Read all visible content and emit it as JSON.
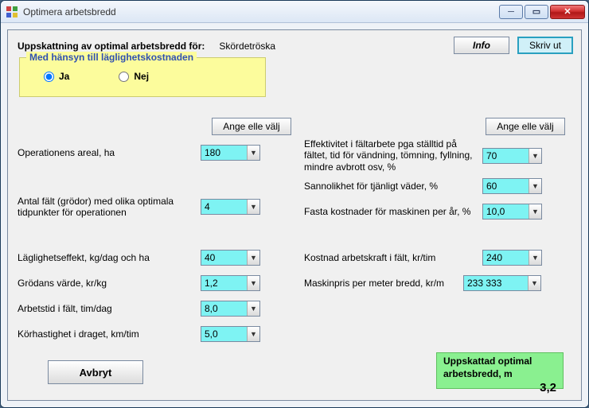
{
  "window": {
    "title": "Optimera arbetsbredd"
  },
  "header": {
    "label": "Uppskattning av optimal arbetsbredd för:",
    "value": "Skördetröska",
    "info": "Info",
    "print": "Skriv ut"
  },
  "group": {
    "title": "Med hänsyn till läglighetskostnaden",
    "yes": "Ja",
    "no": "Nej"
  },
  "colhead": "Ange elle välj",
  "left": {
    "areal_label": "Operationens areal, ha",
    "areal_value": "180",
    "antal_label": "Antal fält (grödor) med olika optimala tidpunkter för operationen",
    "antal_value": "4",
    "lagl_label": "Läglighetseffekt, kg/dag och ha",
    "lagl_value": "40",
    "grod_label": "Grödans värde,  kr/kg",
    "grod_value": "1,2",
    "arb_label": "Arbetstid i fält, tim/dag",
    "arb_value": "8,0",
    "kor_label": "Körhastighet i draget, km/tim",
    "kor_value": "5,0"
  },
  "right": {
    "eff_label": "Effektivitet i fältarbete pga ställtid på fältet, tid för vändning, tömning, fyllning, mindre avbrott osv, %",
    "eff_value": "70",
    "san_label": "Sannolikhet för tjänligt väder,  %",
    "san_value": "60",
    "fast_label": "Fasta kostnader för maskinen per år, %",
    "fast_value": "10,0",
    "kost_label": "Kostnad arbetskraft i fält, kr/tim",
    "kost_value": "240",
    "pris_label": "Maskinpris per meter bredd, kr/m",
    "pris_value": "233 333"
  },
  "cancel": "Avbryt",
  "result": {
    "label": "Uppskattad optimal arbetsbredd, m",
    "value": "3,2"
  }
}
